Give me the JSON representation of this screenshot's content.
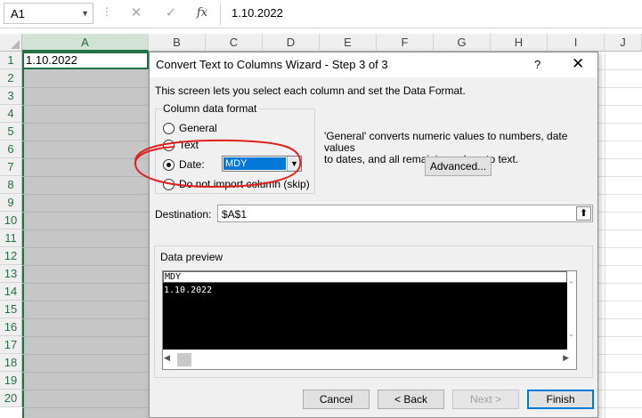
{
  "formula_bar": {
    "name_box": "A1",
    "formula": "1.10.2022",
    "icons": [
      "cancel-icon",
      "enter-icon",
      "function-icon"
    ]
  },
  "grid": {
    "columns": [
      "A",
      "B",
      "C",
      "D",
      "E",
      "F",
      "G",
      "H",
      "I",
      "J"
    ],
    "rows": [
      "1",
      "2",
      "3",
      "4",
      "5",
      "6",
      "7",
      "8",
      "9",
      "10",
      "11",
      "12",
      "13",
      "14",
      "15",
      "16",
      "17",
      "18",
      "19",
      "20"
    ],
    "selected_column": "A",
    "cell_a1": "1.10.2022"
  },
  "dialog": {
    "title": "Convert Text to Columns Wizard - Step 3 of 3",
    "help": "?",
    "close": "✕",
    "intro": "This screen lets you select each column and set the Data Format.",
    "column_format_label": "Column data format",
    "options": {
      "general": "General",
      "text": "Text",
      "date": "Date:",
      "skip": "Do not import column (skip)"
    },
    "selected_option": "date",
    "date_value": "MDY",
    "description_line1": "'General' converts numeric values to numbers, date values",
    "description_line2": "to dates, and all remaining values to text.",
    "advanced_button": "Advanced...",
    "destination_label": "Destination:",
    "destination_value": "$A$1",
    "preview_label": "Data preview",
    "preview_header": "MDY",
    "preview_row": "1.10.2022",
    "buttons": {
      "cancel": "Cancel",
      "back": "< Back",
      "next": "Next >",
      "finish": "Finish"
    }
  },
  "colors": {
    "excel_green": "#217346",
    "selection_gray": "#c6c6c6",
    "accent_blue": "#0078d7",
    "annotation_red": "#e0201c"
  }
}
